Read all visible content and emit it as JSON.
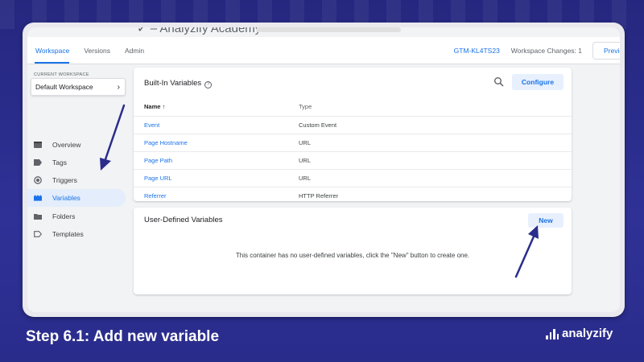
{
  "app": {
    "partial_title": "✓ – Analyzify Academy"
  },
  "topnav": {
    "tabs": [
      {
        "label": "Workspace"
      },
      {
        "label": "Versions"
      },
      {
        "label": "Admin"
      }
    ],
    "container_id": "GTM-KL4TS23",
    "workspace_changes": "Workspace Changes: 1",
    "preview_label": "Preview"
  },
  "sidebar": {
    "current_workspace_label": "CURRENT WORKSPACE",
    "workspace_name": "Default Workspace",
    "items": [
      {
        "label": "Overview",
        "icon": "overview-icon"
      },
      {
        "label": "Tags",
        "icon": "tag-icon"
      },
      {
        "label": "Triggers",
        "icon": "trigger-icon"
      },
      {
        "label": "Variables",
        "icon": "variables-icon",
        "active": true
      },
      {
        "label": "Folders",
        "icon": "folder-icon"
      },
      {
        "label": "Templates",
        "icon": "template-icon"
      }
    ]
  },
  "builtin": {
    "title": "Built-In Variables",
    "configure_label": "Configure",
    "columns": {
      "name": "Name",
      "type": "Type"
    },
    "rows": [
      {
        "name": "Event",
        "type": "Custom Event"
      },
      {
        "name": "Page Hostname",
        "type": "URL"
      },
      {
        "name": "Page Path",
        "type": "URL"
      },
      {
        "name": "Page URL",
        "type": "URL"
      },
      {
        "name": "Referrer",
        "type": "HTTP Referrer"
      }
    ]
  },
  "user_defined": {
    "title": "User-Defined Variables",
    "new_label": "New",
    "empty_message": "This container has no user-defined variables, click the \"New\" button to create one."
  },
  "caption": "Step 6.1: Add new variable",
  "brand": {
    "name": "analyzify"
  },
  "colors": {
    "accent": "#1a73e8",
    "annotation": "#2b2d8c",
    "background": "#2d2e8f"
  }
}
